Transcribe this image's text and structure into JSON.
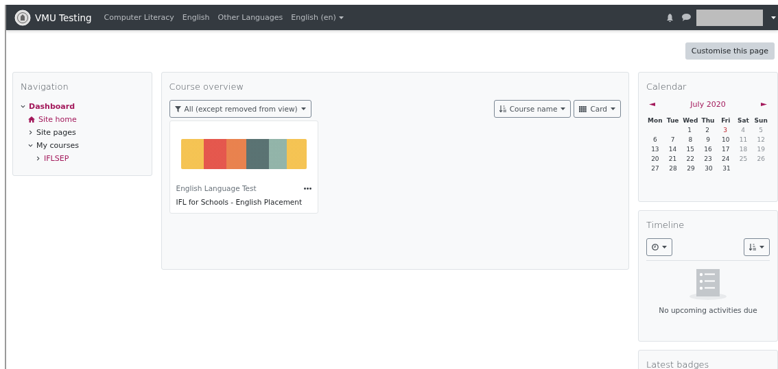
{
  "navbar": {
    "brand": "VMU Testing",
    "links": [
      {
        "label": "Computer Literacy",
        "dropdown": false
      },
      {
        "label": "English",
        "dropdown": false
      },
      {
        "label": "Other Languages",
        "dropdown": false
      },
      {
        "label": "English (en)",
        "dropdown": true
      }
    ]
  },
  "header": {
    "button": "Customise this page"
  },
  "navigation": {
    "title": "Navigation",
    "items": [
      {
        "label": "Dashboard",
        "kind": "branch",
        "expanded": true,
        "current": true,
        "link": true,
        "children": [
          {
            "label": "Site home",
            "kind": "home",
            "current": false,
            "link": true
          },
          {
            "label": "Site pages",
            "kind": "branch",
            "expanded": false,
            "current": false,
            "link": false
          },
          {
            "label": "My courses",
            "kind": "branch",
            "expanded": true,
            "current": false,
            "link": false,
            "children": [
              {
                "label": "IFLSEP",
                "kind": "branch",
                "expanded": false,
                "current": false,
                "link": true
              }
            ]
          }
        ]
      }
    ]
  },
  "course_overview": {
    "title": "Course overview",
    "filter": "All (except removed from view)",
    "sort": "Course name",
    "view": "Card",
    "courses": [
      {
        "category": "English Language Test",
        "name": "IFL for Schools - English Placement"
      }
    ]
  },
  "calendar": {
    "title": "Calendar",
    "month": "July 2020",
    "weekdays": [
      "Mon",
      "Tue",
      "Wed",
      "Thu",
      "Fri",
      "Sat",
      "Sun"
    ],
    "weeks": [
      {
        "kind": "leading_gap",
        "days": [
          {
            "d": "1",
            "today": false
          },
          {
            "d": "2",
            "today": false
          },
          {
            "d": "3",
            "today": true
          },
          {
            "d": "4",
            "today": false
          },
          {
            "d": "5",
            "today": false
          }
        ]
      },
      {
        "days": [
          {
            "d": "6",
            "today": false
          },
          {
            "d": "7",
            "today": false
          },
          {
            "d": "8",
            "today": false
          },
          {
            "d": "9",
            "today": false
          },
          {
            "d": "10",
            "today": false
          },
          {
            "d": "11",
            "today": false
          },
          {
            "d": "12",
            "today": false
          }
        ]
      },
      {
        "days": [
          {
            "d": "13",
            "today": false
          },
          {
            "d": "14",
            "today": false
          },
          {
            "d": "15",
            "today": false
          },
          {
            "d": "16",
            "today": false
          },
          {
            "d": "17",
            "today": false
          },
          {
            "d": "18",
            "today": false
          },
          {
            "d": "19",
            "today": false
          }
        ]
      },
      {
        "days": [
          {
            "d": "20",
            "today": false
          },
          {
            "d": "21",
            "today": false
          },
          {
            "d": "22",
            "today": false
          },
          {
            "d": "23",
            "today": false
          },
          {
            "d": "24",
            "today": false
          },
          {
            "d": "25",
            "today": false
          },
          {
            "d": "26",
            "today": false
          }
        ]
      },
      {
        "kind": "trailing_gap",
        "days": [
          {
            "d": "27",
            "today": false
          },
          {
            "d": "28",
            "today": false
          },
          {
            "d": "29",
            "today": false
          },
          {
            "d": "30",
            "today": false
          },
          {
            "d": "31",
            "today": false
          }
        ]
      }
    ]
  },
  "timeline": {
    "title": "Timeline",
    "empty_message": "No upcoming activities due"
  },
  "latest_badges": {
    "title": "Latest badges"
  }
}
